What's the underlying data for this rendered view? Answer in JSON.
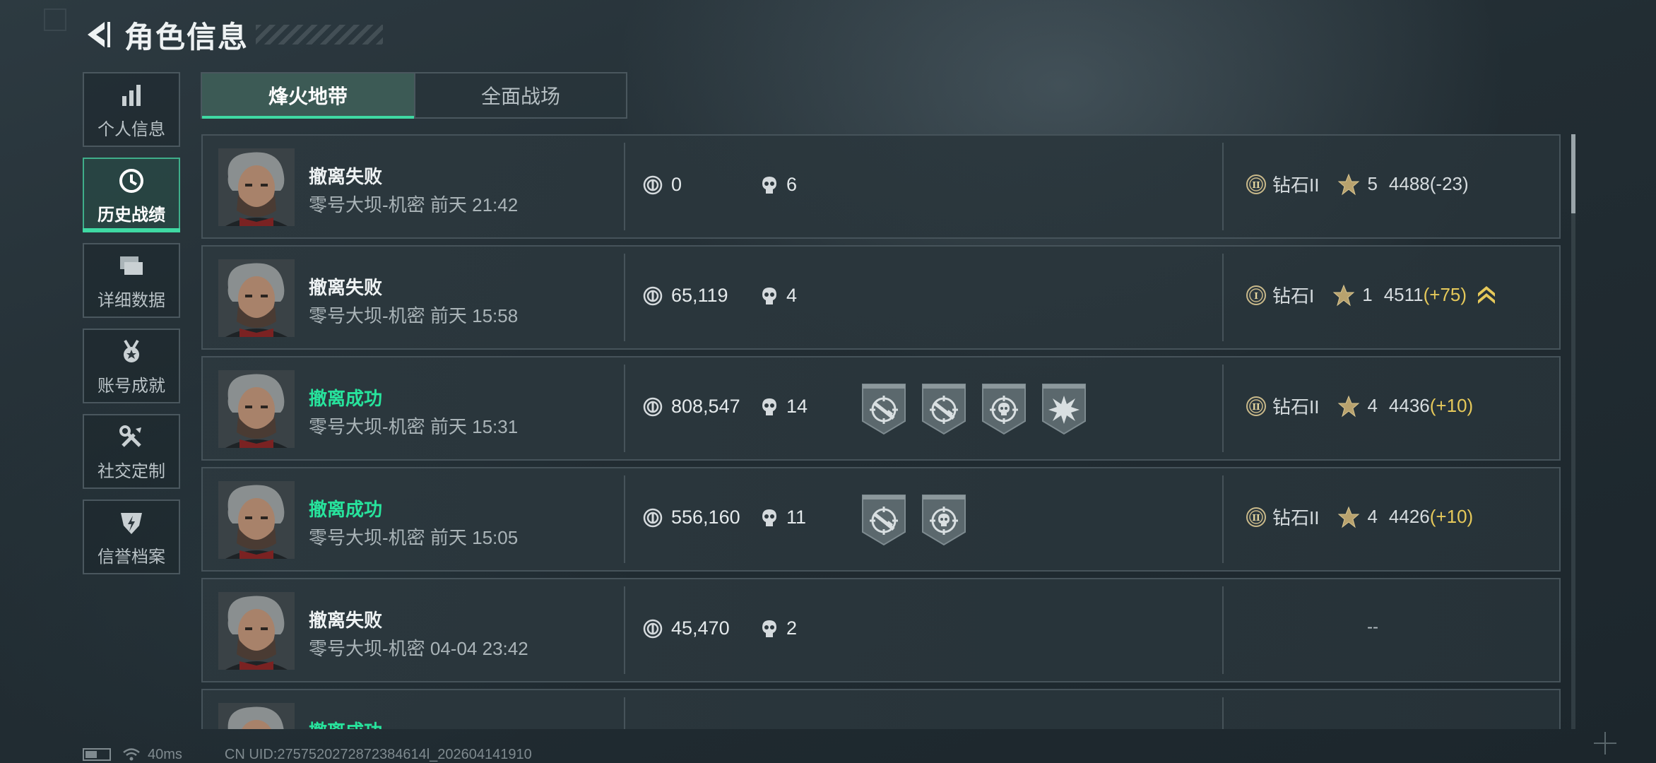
{
  "header": {
    "title": "角色信息"
  },
  "sidebar": {
    "items": [
      {
        "label": "个人信息",
        "icon": "bar-chart-icon",
        "active": false
      },
      {
        "label": "历史战绩",
        "icon": "clock-history-icon",
        "active": true
      },
      {
        "label": "详细数据",
        "icon": "folders-icon",
        "active": false
      },
      {
        "label": "账号成就",
        "icon": "medal-icon",
        "active": false
      },
      {
        "label": "社交定制",
        "icon": "tools-icon",
        "active": false
      },
      {
        "label": "信誉档案",
        "icon": "shield-bolt-icon",
        "active": false
      }
    ]
  },
  "tabs": [
    {
      "label": "烽火地带",
      "active": true
    },
    {
      "label": "全面战场",
      "active": false
    }
  ],
  "matches": [
    {
      "status": "撤离失败",
      "success": false,
      "info": "零号大坝-机密 前天 21:42",
      "money": "0",
      "kills": "6",
      "badges": [],
      "rank_tier": "钻石II",
      "stars": "5",
      "score": "4488",
      "delta": "(-23)",
      "delta_up": false,
      "promo": false,
      "has_rank": true
    },
    {
      "status": "撤离失败",
      "success": false,
      "info": "零号大坝-机密 前天 15:58",
      "money": "65,119",
      "kills": "4",
      "badges": [],
      "rank_tier": "钻石I",
      "stars": "1",
      "score": "4511",
      "delta": "(+75)",
      "delta_up": true,
      "promo": true,
      "has_rank": true
    },
    {
      "status": "撤离成功",
      "success": true,
      "info": "零号大坝-机密 前天 15:31",
      "money": "808,547",
      "kills": "14",
      "badges": [
        "rifle-crosshair-badge-icon",
        "rifle-crosshair-badge-icon",
        "skull-crosshair-badge-icon",
        "explosion-badge-icon"
      ],
      "rank_tier": "钻石II",
      "stars": "4",
      "score": "4436",
      "delta": "(+10)",
      "delta_up": true,
      "promo": false,
      "has_rank": true
    },
    {
      "status": "撤离成功",
      "success": true,
      "info": "零号大坝-机密 前天 15:05",
      "money": "556,160",
      "kills": "11",
      "badges": [
        "rifle-crosshair-badge-icon",
        "skull-crosshair-badge-icon"
      ],
      "rank_tier": "钻石II",
      "stars": "4",
      "score": "4426",
      "delta": "(+10)",
      "delta_up": true,
      "promo": false,
      "has_rank": true
    },
    {
      "status": "撤离失败",
      "success": false,
      "info": "零号大坝-机密 04-04 23:42",
      "money": "45,470",
      "kills": "2",
      "badges": [],
      "rank_tier": "",
      "stars": "",
      "score": "",
      "delta": "",
      "delta_up": false,
      "promo": false,
      "has_rank": false,
      "rank_placeholder": "--"
    },
    {
      "status": "撤离成功",
      "success": true,
      "info": "",
      "money": "",
      "kills": "",
      "badges": [],
      "rank_tier": "",
      "stars": "",
      "score": "",
      "delta": "",
      "delta_up": false,
      "promo": false,
      "has_rank": false,
      "partial": true
    }
  ],
  "footer": {
    "ping": "40ms",
    "uid": "CN UID:2757520272872384614l_202604141910"
  },
  "colors": {
    "accent": "#3fd9a3",
    "success": "#27e39c",
    "gold": "#e6c95a"
  }
}
